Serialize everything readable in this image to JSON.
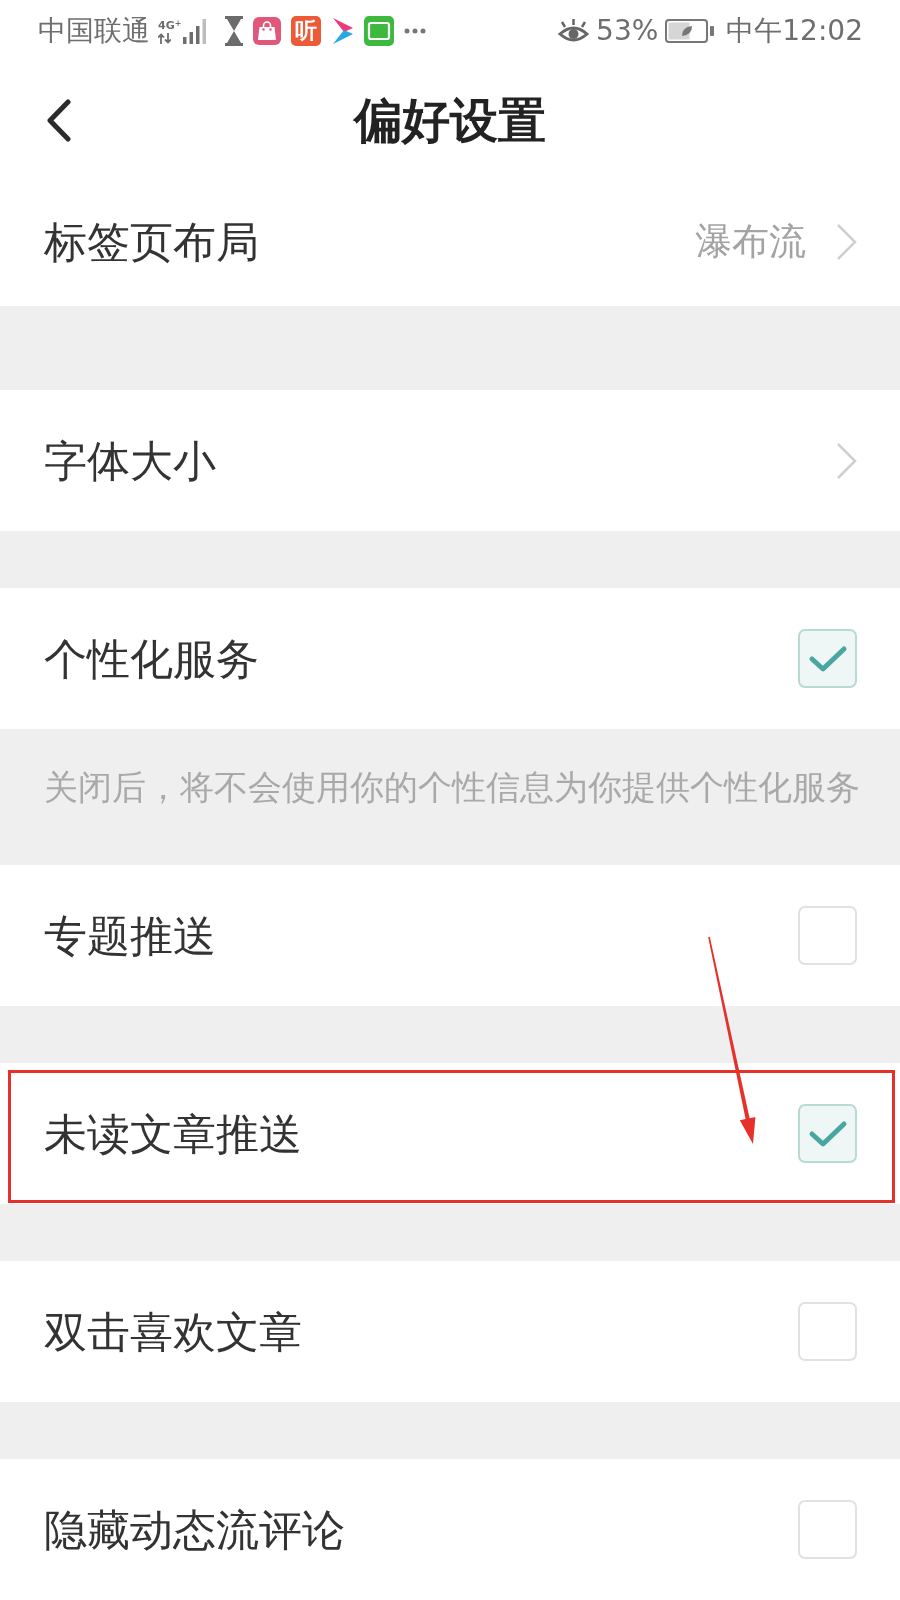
{
  "status_bar": {
    "carrier": "中国联通",
    "network_type": "4G$^{+}$",
    "notification_icons": [
      {
        "kind": "bag"
      },
      {
        "kind": "glyph",
        "label": "听"
      },
      {
        "kind": "play"
      },
      {
        "kind": "screen"
      }
    ],
    "battery": "53%",
    "time": "中午12:02"
  },
  "header": {
    "title": "偏好设置"
  },
  "sections": [
    {
      "rows": [
        {
          "kind": "link",
          "label": "标签页布局",
          "value": "瀑布流",
          "highlighted": false
        }
      ]
    },
    {
      "rows": [
        {
          "kind": "link",
          "label": "字体大小",
          "highlighted": false
        }
      ]
    },
    {
      "rows": [
        {
          "kind": "checkbox",
          "label": "个性化服务",
          "checked": true,
          "highlighted": false
        }
      ],
      "note": "关闭后，将不会使用你的个性信息为你提供个性化服务"
    },
    {
      "rows": [
        {
          "kind": "checkbox",
          "label": "专题推送",
          "checked": false,
          "highlighted": false
        }
      ]
    },
    {
      "rows": [
        {
          "kind": "checkbox",
          "label": "未读文章推送",
          "checked": true,
          "highlighted": true
        }
      ]
    },
    {
      "rows": [
        {
          "kind": "checkbox",
          "label": "双击喜欢文章",
          "checked": false,
          "highlighted": false
        }
      ]
    },
    {
      "rows": [
        {
          "kind": "checkbox",
          "label": "隐藏动态流评论",
          "checked": false,
          "highlighted": false
        }
      ]
    }
  ]
}
